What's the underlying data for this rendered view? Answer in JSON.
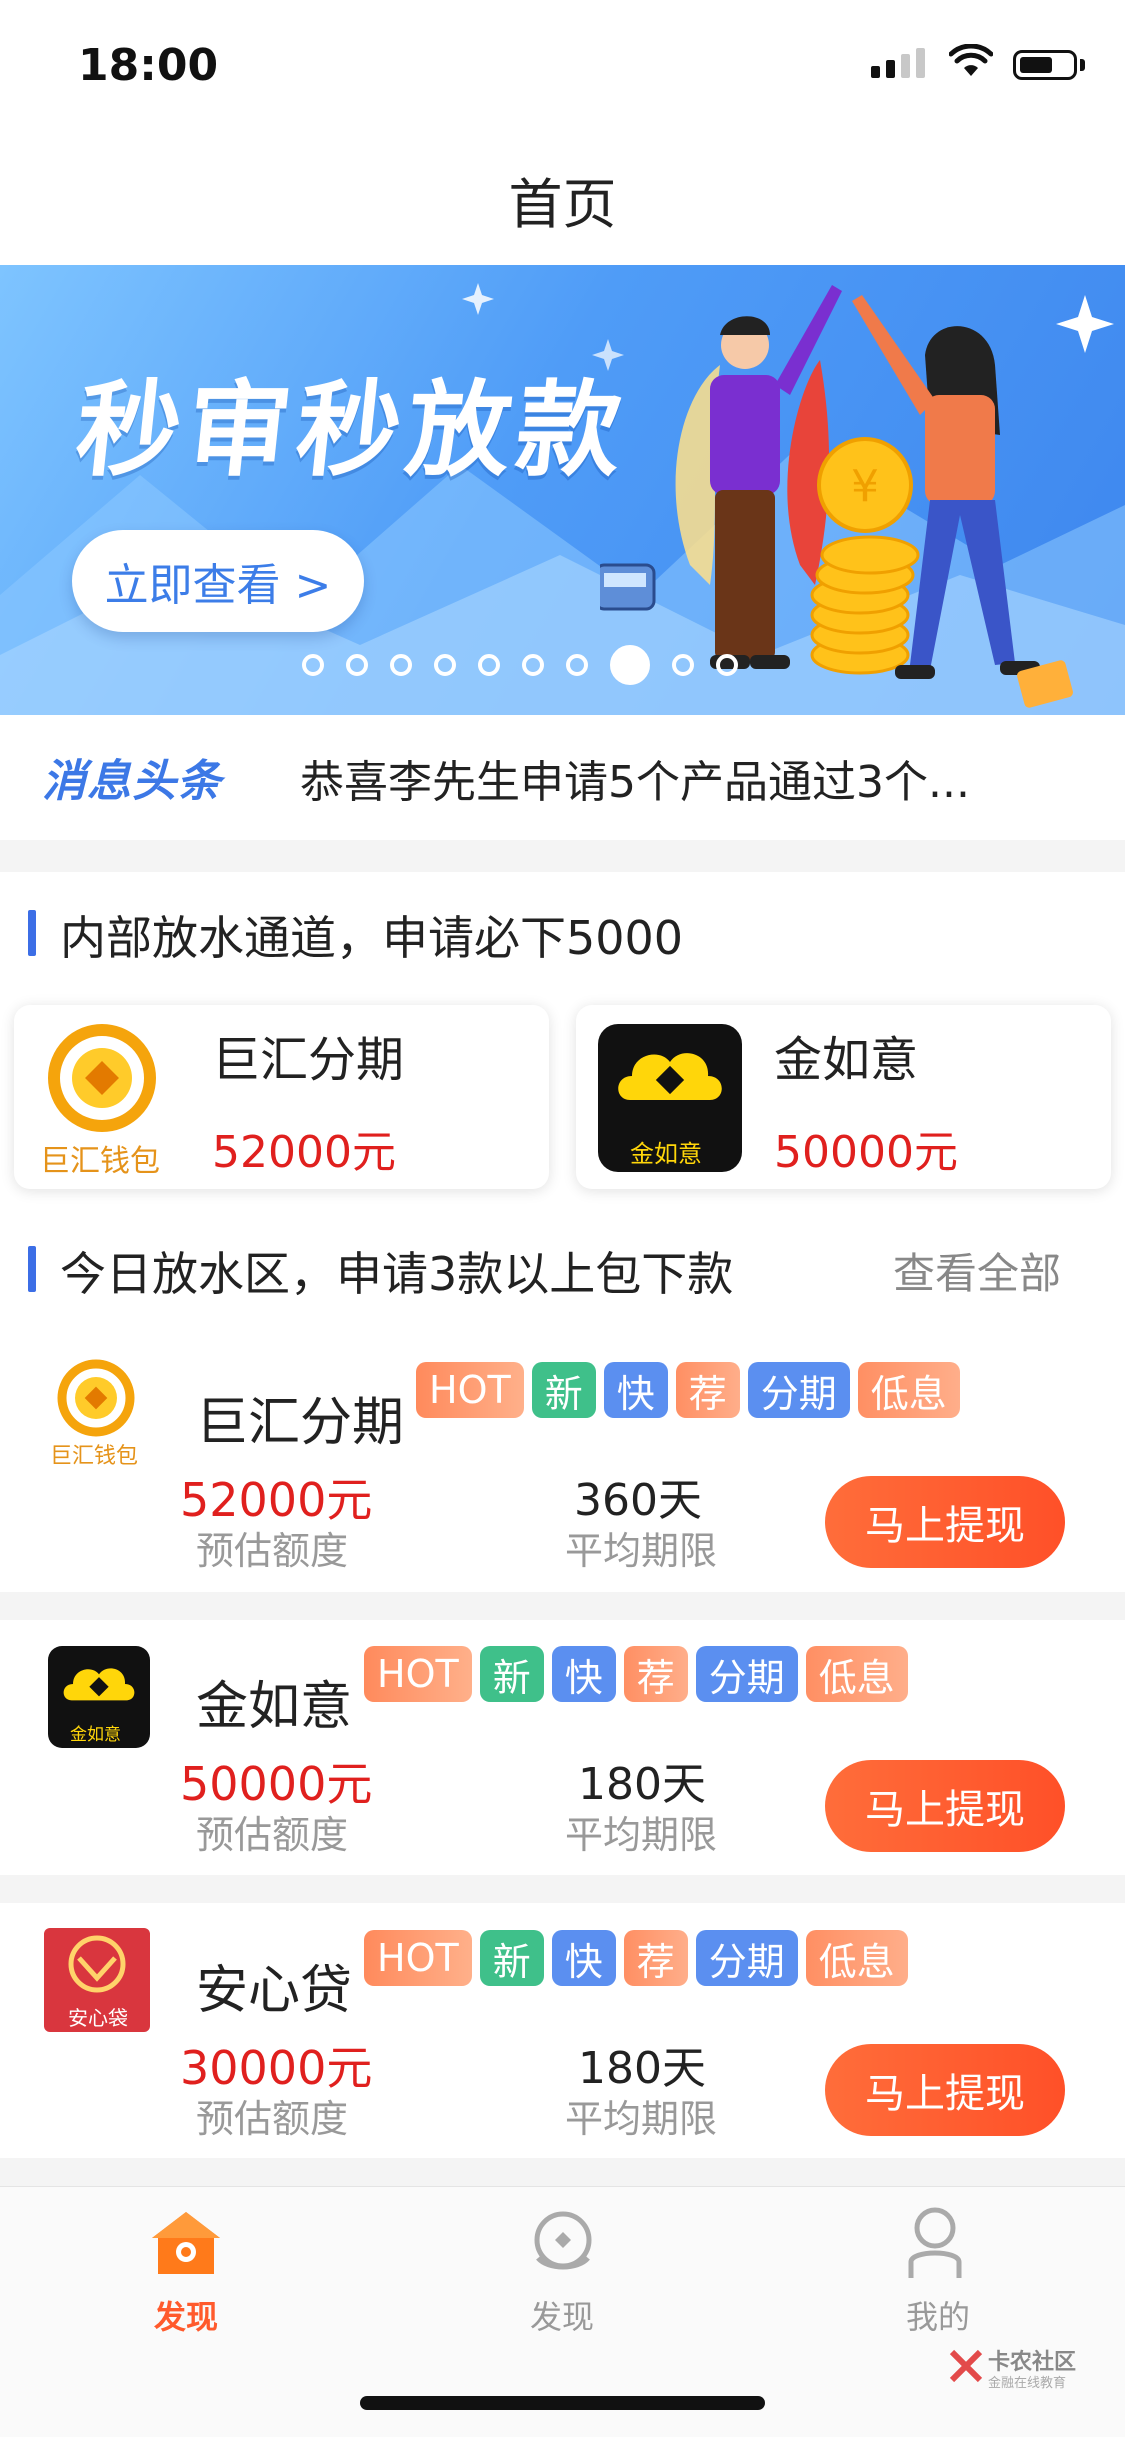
{
  "status_bar": {
    "time": "18:00"
  },
  "nav": {
    "title": "首页"
  },
  "banner": {
    "title": "秒审秒放款",
    "button_label": "立即查看 >",
    "dot_count": 10,
    "active_dot": 7
  },
  "news": {
    "tag": "消息头条",
    "text": "恭喜李先生申请5个产品通过3个..."
  },
  "featured": {
    "title": "内部放水通道，申请必下5000",
    "cards": [
      {
        "name": "巨汇分期",
        "amount": "52000元",
        "logo_text": "巨汇钱包"
      },
      {
        "name": "金如意",
        "amount": "50000元",
        "logo_text": "金如意"
      }
    ]
  },
  "today": {
    "title": "今日放水区，申请3款以上包下款",
    "view_all": "查看全部",
    "amount_label": "预估额度",
    "period_label": "平均期限",
    "button_label": "马上提现",
    "tags": [
      "HOT",
      "新",
      "快",
      "荐",
      "分期",
      "低息"
    ],
    "items": [
      {
        "name": "巨汇分期",
        "amount": "52000元",
        "days": "360天",
        "logo_text": "巨汇钱包"
      },
      {
        "name": "金如意",
        "amount": "50000元",
        "days": "180天",
        "logo_text": "金如意"
      },
      {
        "name": "安心贷",
        "amount": "30000元",
        "days": "180天",
        "logo_text": "安心袋"
      }
    ]
  },
  "tabbar": {
    "tabs": [
      {
        "label": "发现",
        "icon": "home-icon"
      },
      {
        "label": "发现",
        "icon": "discover-icon"
      },
      {
        "label": "我的",
        "icon": "profile-icon"
      }
    ]
  },
  "watermark": {
    "text": "卡农社区",
    "subtext": "金融在线教育"
  },
  "colors": {
    "accent_red": "#e0201e",
    "button_orange": "#ff5a2c",
    "blue": "#3c78e6"
  }
}
